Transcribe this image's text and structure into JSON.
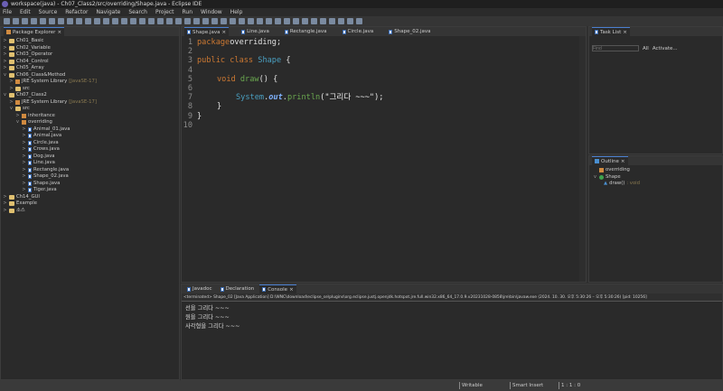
{
  "window": {
    "title": "workspace(java) - Ch07_Class2/src/overriding/Shape.java - Eclipse IDE"
  },
  "menu": [
    "File",
    "Edit",
    "Source",
    "Refactor",
    "Navigate",
    "Search",
    "Project",
    "Run",
    "Window",
    "Help"
  ],
  "package_explorer": {
    "title": "Package Explorer",
    "items": [
      {
        "label": "Ch01_Basic",
        "depth": 0,
        "type": "project",
        "exp": ">"
      },
      {
        "label": "Ch02_Variable",
        "depth": 0,
        "type": "project",
        "exp": ">"
      },
      {
        "label": "Ch03_Operator",
        "depth": 0,
        "type": "project",
        "exp": ">"
      },
      {
        "label": "Ch04_Control",
        "depth": 0,
        "type": "project",
        "exp": ">"
      },
      {
        "label": "Ch05_Array",
        "depth": 0,
        "type": "project",
        "exp": ">"
      },
      {
        "label": "Ch06_Class&Method",
        "depth": 0,
        "type": "project",
        "exp": "v"
      },
      {
        "label": "JRE System Library",
        "suffix": "[JavaSE-17]",
        "depth": 1,
        "type": "lib",
        "exp": ">"
      },
      {
        "label": "src",
        "depth": 1,
        "type": "project",
        "exp": ">"
      },
      {
        "label": "Ch07_Class2",
        "depth": 0,
        "type": "project",
        "exp": "v"
      },
      {
        "label": "JRE System Library",
        "suffix": "[JavaSE-17]",
        "depth": 1,
        "type": "lib",
        "exp": ">"
      },
      {
        "label": "src",
        "depth": 1,
        "type": "project",
        "exp": "v"
      },
      {
        "label": "inheritance",
        "depth": 2,
        "type": "pkg",
        "exp": ">"
      },
      {
        "label": "overriding",
        "depth": 2,
        "type": "pkg",
        "exp": "v"
      },
      {
        "label": "Animal_01.java",
        "depth": 3,
        "type": "java",
        "exp": ">"
      },
      {
        "label": "Animal.java",
        "depth": 3,
        "type": "java",
        "exp": ">"
      },
      {
        "label": "Circle.java",
        "depth": 3,
        "type": "java",
        "exp": ">"
      },
      {
        "label": "Crows.java",
        "depth": 3,
        "type": "java",
        "exp": ">"
      },
      {
        "label": "Dog.java",
        "depth": 3,
        "type": "java",
        "exp": ">"
      },
      {
        "label": "Line.java",
        "depth": 3,
        "type": "java",
        "exp": ">"
      },
      {
        "label": "Rectangle.java",
        "depth": 3,
        "type": "java",
        "exp": ">"
      },
      {
        "label": "Shape_02.java",
        "depth": 3,
        "type": "java",
        "exp": ">"
      },
      {
        "label": "Shape.java",
        "depth": 3,
        "type": "java",
        "exp": ">"
      },
      {
        "label": "Tiger.java",
        "depth": 3,
        "type": "java",
        "exp": ">"
      },
      {
        "label": "Ch14_GUI",
        "depth": 0,
        "type": "project",
        "exp": ">"
      },
      {
        "label": "Example",
        "depth": 0,
        "type": "project",
        "exp": ">"
      },
      {
        "label": "소스",
        "depth": 0,
        "type": "project",
        "exp": ">"
      }
    ]
  },
  "editor": {
    "tabs": [
      "Shape.java",
      "Line.java",
      "Rectangle.java",
      "Circle.java",
      "Shape_02.java"
    ],
    "lines": [
      "1",
      "2",
      "3",
      "4",
      "5",
      "6",
      "7",
      "8",
      "9",
      "10"
    ],
    "code": {
      "l1a": "package",
      "l1b": " overriding;",
      "l3a": "public class ",
      "l3b": "Shape",
      "l3c": " {",
      "l5a": "void ",
      "l5b": "draw",
      "l5c": "() {",
      "l7a": "System",
      "l7b": ".",
      "l7c": "out",
      "l7d": ".",
      "l7e": "println",
      "l7f": "(\"그리다 ~~~\");",
      "l8": "}",
      "l9": "}"
    }
  },
  "task_list": {
    "title": "Task List",
    "find_placeholder": "Find",
    "all": "All",
    "activate": "Activate..."
  },
  "outline": {
    "title": "Outline",
    "items": [
      {
        "label": "overriding"
      },
      {
        "label": "Shape"
      },
      {
        "label": "draw()",
        "suffix": " : void"
      }
    ]
  },
  "bottom": {
    "tabs": [
      "Javadoc",
      "Declaration",
      "Console"
    ],
    "header": "<terminated> Shape_02 [Java Application] D:\\WNC\\download\\eclipse_se\\plugins\\org.eclipse.justj.openjdk.hotspot.jre.full.win32.x86_64_17.0.9.v20231028-0858\\jre\\bin\\javaw.exe  (2024. 10. 30. 오후 5:30:26 – 오후 5:30:26) [pid: 10256]",
    "output": [
      "선을 그리다 ~~~",
      "원을 그리다 ~~~",
      "사각형을 그리다 ~~~"
    ]
  },
  "status": {
    "writable": "Writable",
    "insert": "Smart Insert",
    "position": "1 : 1 : 0"
  }
}
